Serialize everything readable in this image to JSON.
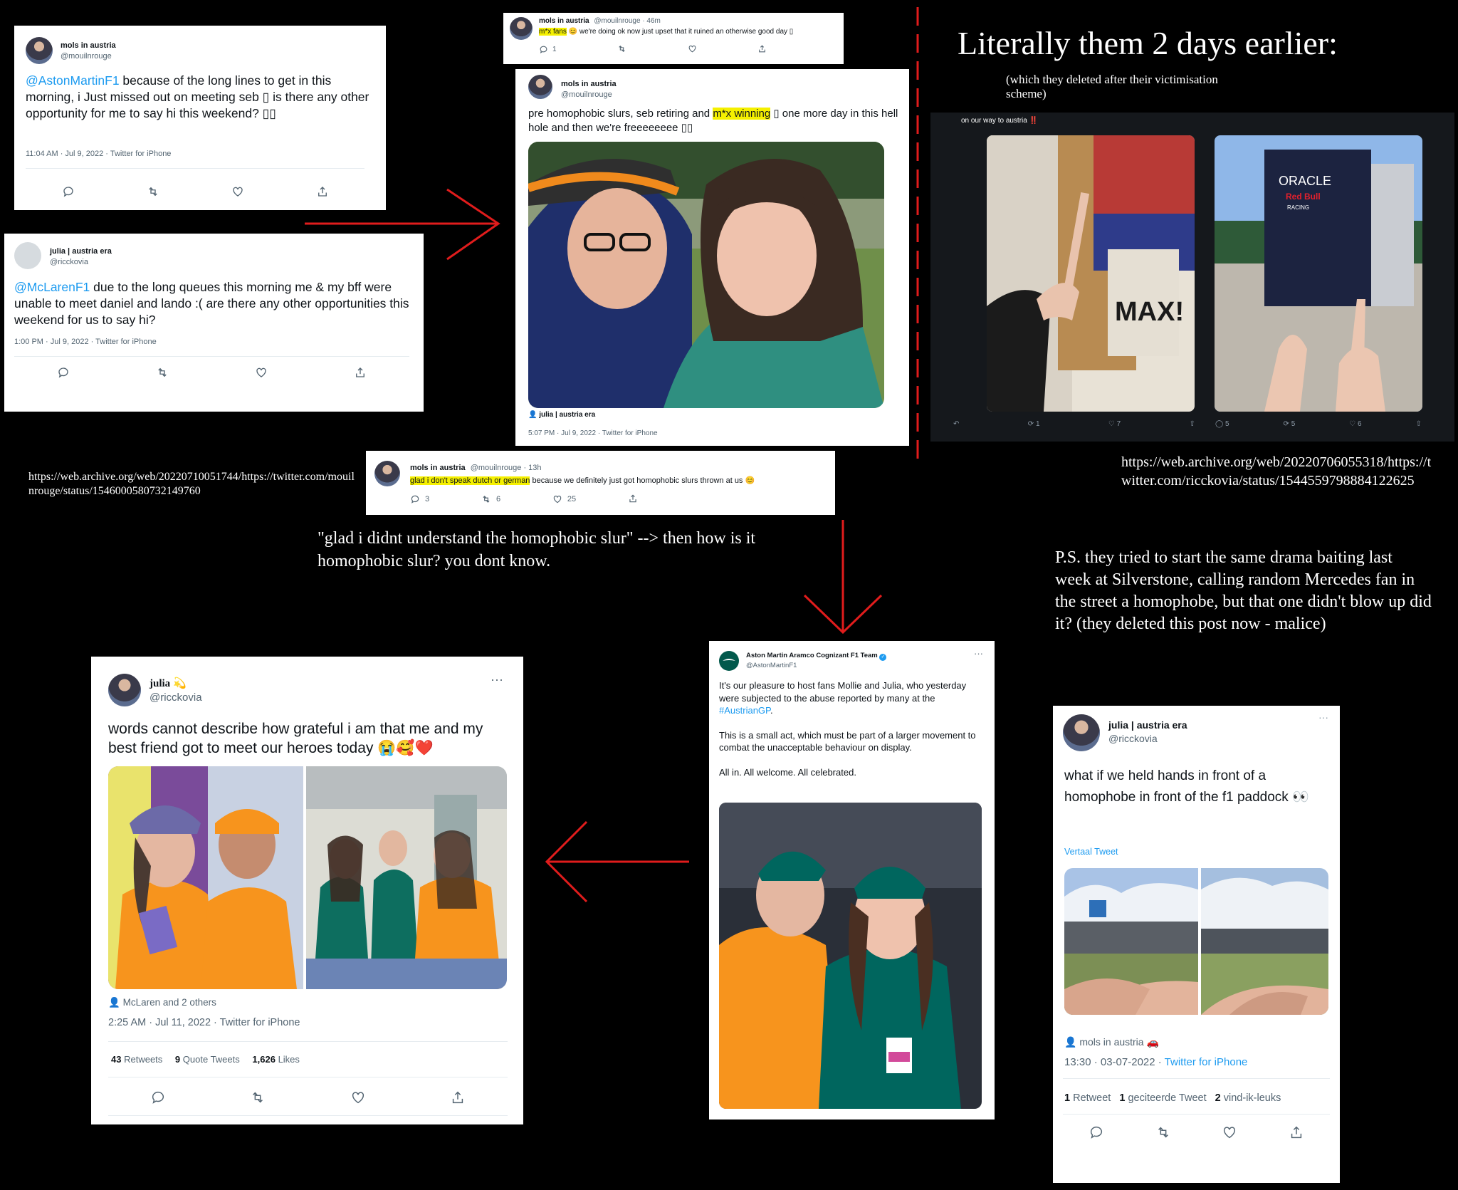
{
  "t1": {
    "name": "mols in austria",
    "handle": "@mouilnrouge",
    "text_mention": "@AstonMartinF1",
    "text": " because of the long lines to get in this morning, i Just missed out on meeting seb ▯ is there any other opportunity for me to say hi this weekend? ▯▯",
    "meta": "11:04 AM · Jul 9, 2022 · Twitter for iPhone"
  },
  "t2": {
    "name": "julia | austria era",
    "handle": "@ricckovia",
    "text_mention": "@McLarenF1",
    "text": " due to the long queues this morning me & my bff were unable to meet daniel and lando :( are there any other opportunities this weekend for us to say hi?",
    "meta": "1:00 PM · Jul 9, 2022 · Twitter for iPhone"
  },
  "t3": {
    "name": "mols in austria",
    "handle": "@mouilnrouge · 46m",
    "hl": "m*x fans",
    "text": " 😊 we're doing ok now just upset that it ruined an otherwise good day ▯",
    "reply_count": "1"
  },
  "t4": {
    "name": "mols in austria",
    "handle": "@mouilnrouge",
    "text_a": "pre homophobic slurs, seb retiring and ",
    "hl": "m*x winning",
    "text_b": " ▯ one more day in this hell hole and then we're freeeeeeee ▯▯",
    "tag": "julia | austria era",
    "meta": "5:07 PM · Jul 9, 2022 · Twitter for iPhone"
  },
  "t5": {
    "name": "mols in austria",
    "handle": "@mouilnrouge · 13h",
    "hl": "glad i don't speak dutch or german",
    "text": " because we definitely just got homophobic slurs thrown at us 😊",
    "replies": "3",
    "retweets": "6",
    "likes": "25"
  },
  "t6": {
    "name": "julia",
    "handle": "@ricckovia",
    "text": "words cannot describe how grateful i am that me and my best friend got to meet our heroes today 😭🥰❤️",
    "tag": "McLaren and 2 others",
    "meta": "2:25 AM · Jul 11, 2022 · Twitter for iPhone",
    "retweets_n": "43",
    "retweets_l": "Retweets",
    "quotes_n": "9",
    "quotes_l": "Quote Tweets",
    "likes_n": "1,626",
    "likes_l": "Likes"
  },
  "t7": {
    "name": "Aston Martin Aramco Cognizant F1 Team",
    "handle": "@AstonMartinF1",
    "p1_a": "It's our pleasure to host fans Mollie and Julia, who yesterday were subjected to the abuse reported by many at the ",
    "p1_tag": "#AustrianGP",
    "p1_b": ".",
    "p2": "This is a small act, which must be part of a larger movement to combat the unacceptable behaviour on display.",
    "p3": "All in. All welcome. All celebrated."
  },
  "t8": {
    "name": "julia | austria era",
    "handle": "@ricckovia",
    "text": "what if we held hands in front of a homophobe in front of the f1 paddock 👀",
    "translate": "Vertaal Tweet",
    "tag": "mols in austria",
    "meta_a": "13:30 · 03-07-2022 · ",
    "meta_b": "Twitter for iPhone",
    "s1n": "1",
    "s1": "Retweet",
    "s2n": "1",
    "s2": "geciteerde Tweet",
    "s3n": "2",
    "s3": "vind-ik-leuks"
  },
  "rt": {
    "caption": "on our way to austria ‼️",
    "c1": "1",
    "c2": "7",
    "c3": "5",
    "c4": "5",
    "c5": "6",
    "truck_brand": "ORACLE",
    "truck_sub": "Red Bull",
    "truck_racing": "RACING",
    "magazine": "MAX!"
  },
  "notes": {
    "heading": "Literally them 2 days earlier:",
    "sub": "(which they deleted after their victimisation scheme)",
    "url_left": "https://web.archive.org/web/20220710051744/https://twitter.com/mouilnrouge/status/1546000580732149760",
    "url_right": "https://web.archive.org/web/20220706055318/https://twitter.com/ricckovia/status/1544559798884122625",
    "quote": "\"glad i didnt understand the homophobic slur\" --> then how is it homophobic slur? you dont know.",
    "ps": "P.S. they tried to start the same drama baiting last week at Silverstone, calling random Mercedes fan in the street a homophobe, but that one didn't blow up did it? (they deleted this post now - malice)"
  },
  "colors": {
    "link": "#1d9bf0",
    "highlight": "#f5f000",
    "arrow": "#e01c1c",
    "mclaren": "#f7941d",
    "aston": "#00665e"
  }
}
